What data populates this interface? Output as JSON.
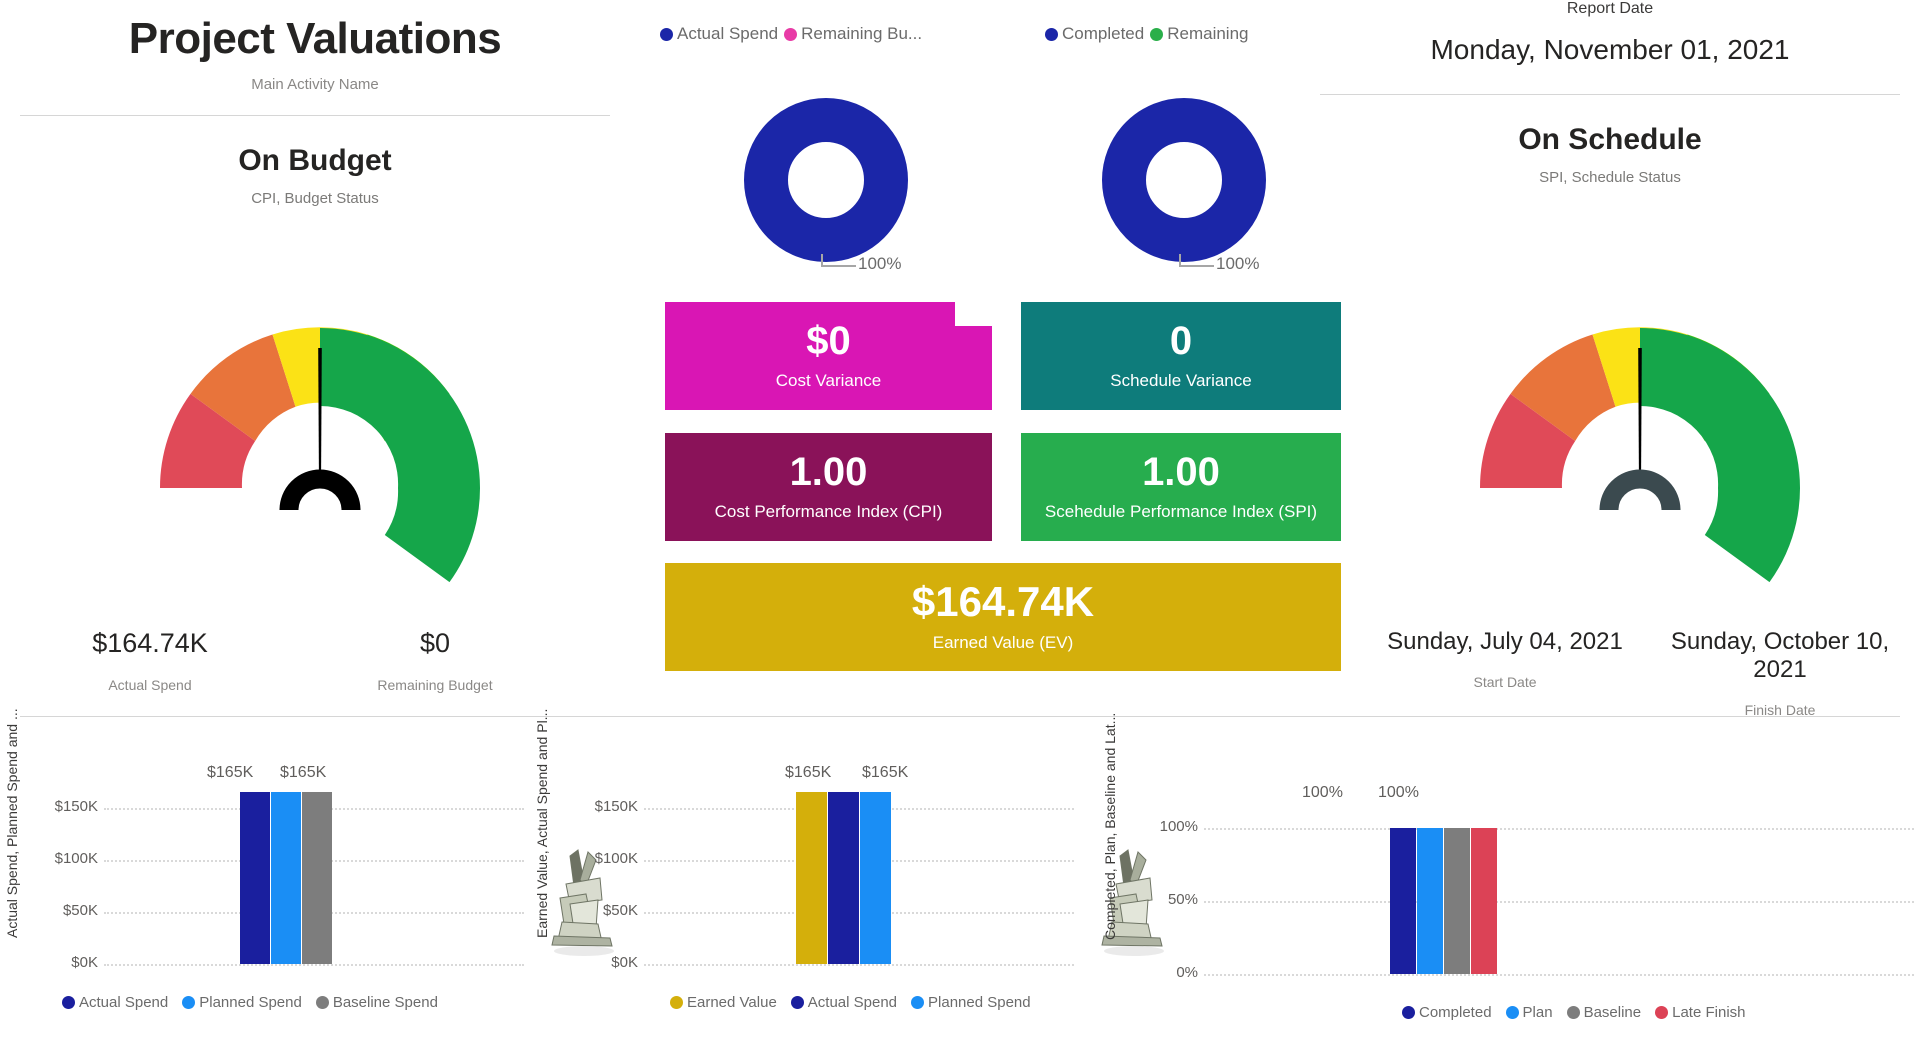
{
  "header": {
    "title": "Project Valuations",
    "subtitle": "Main Activity Name",
    "report_date_label": "Report Date",
    "report_date_value": "Monday, November 01, 2021"
  },
  "budget_panel": {
    "title": "On Budget",
    "subtitle": "CPI, Budget Status",
    "needle_color": "#000000",
    "hub_color": "#000000",
    "left_value": "$164.74K",
    "left_label": "Actual Spend",
    "right_value": "$0",
    "right_label": "Remaining Budget"
  },
  "schedule_panel": {
    "title": "On Schedule",
    "subtitle": "SPI, Schedule Status",
    "needle_color": "#000000",
    "hub_color": "#3b4a4f",
    "left_value": "Sunday, July 04, 2021",
    "left_label": "Start Date",
    "right_value": "Sunday, October 10, 2021",
    "right_label": "Finish Date"
  },
  "gauge_bands": [
    {
      "name": "red",
      "color": "#e04a58"
    },
    {
      "name": "orange",
      "color": "#e8743b"
    },
    {
      "name": "yellow",
      "color": "#fbe216"
    },
    {
      "name": "lightgreen",
      "color": "#4cc800"
    },
    {
      "name": "green",
      "color": "#15a64a"
    }
  ],
  "donuts": [
    {
      "name": "spend-donut",
      "legend": [
        {
          "label": "Actual Spend",
          "color": "#1b26a8"
        },
        {
          "label": "Remaining Bu...",
          "color": "#e83ba6"
        }
      ],
      "value_label": "100%",
      "ring_color": "#1b26a8"
    },
    {
      "name": "progress-donut",
      "legend": [
        {
          "label": "Completed",
          "color": "#1b26a8"
        },
        {
          "label": "Remaining",
          "color": "#2aaf4a"
        }
      ],
      "value_label": "100%",
      "ring_color": "#1b26a8"
    }
  ],
  "kpi_cards": [
    {
      "name": "cost-variance",
      "value": "$0",
      "label": "Cost Variance",
      "color": "#d916b4",
      "notch": true
    },
    {
      "name": "schedule-variance",
      "value": "0",
      "label": "Schedule Variance",
      "color": "#0e7c7b",
      "notch": false
    },
    {
      "name": "cpi",
      "value": "1.00",
      "label": "Cost Performance Index (CPI)",
      "color": "#8a1259",
      "notch": false
    },
    {
      "name": "spi",
      "value": "1.00",
      "label": "Scehedule Performance Index (SPI)",
      "color": "#27ad4e",
      "notch": false
    },
    {
      "name": "earned-value",
      "value": "$164.74K",
      "label": "Earned Value (EV)",
      "color": "#d4af0b",
      "notch": false
    }
  ],
  "chart_data": [
    {
      "name": "spend-comparison-chart",
      "type": "bar",
      "ylabel": "Actual Spend, Planned Spend and ...",
      "categories": [
        ""
      ],
      "yticks": [
        "$0K",
        "$50K",
        "$100K",
        "$150K"
      ],
      "ytick_values": [
        0,
        50000,
        100000,
        150000
      ],
      "ylim": [
        0,
        175000
      ],
      "grid": true,
      "legend_position": "bottom",
      "series": [
        {
          "name": "Actual Spend",
          "color": "#1a1f9e",
          "values": [
            165000
          ],
          "data_label": "$165K"
        },
        {
          "name": "Planned Spend",
          "color": "#1a8ef5",
          "values": [
            165000
          ],
          "data_label": "$165K"
        },
        {
          "name": "Baseline Spend",
          "color": "#7d7d7d",
          "values": [
            165000
          ],
          "data_label": ""
        }
      ]
    },
    {
      "name": "earned-value-chart",
      "type": "bar",
      "ylabel": "Earned Value, Actual Spend and Pl...",
      "categories": [
        ""
      ],
      "yticks": [
        "$0K",
        "$50K",
        "$100K",
        "$150K"
      ],
      "ytick_values": [
        0,
        50000,
        100000,
        150000
      ],
      "ylim": [
        0,
        175000
      ],
      "grid": true,
      "legend_position": "bottom",
      "series": [
        {
          "name": "Earned Value",
          "color": "#d4af0b",
          "values": [
            165000
          ],
          "data_label": "$165K"
        },
        {
          "name": "Actual Spend",
          "color": "#1a1f9e",
          "values": [
            165000
          ],
          "data_label": "$165K"
        },
        {
          "name": "Planned Spend",
          "color": "#1a8ef5",
          "values": [
            165000
          ],
          "data_label": ""
        }
      ]
    },
    {
      "name": "completion-chart",
      "type": "bar",
      "ylabel": "Completed, Plan, Baseline and Lat...",
      "categories": [
        ""
      ],
      "yticks": [
        "0%",
        "50%",
        "100%"
      ],
      "ytick_values": [
        0,
        50,
        100
      ],
      "ylim": [
        0,
        108
      ],
      "grid": true,
      "legend_position": "bottom",
      "series": [
        {
          "name": "Completed",
          "color": "#1a1f9e",
          "values": [
            100
          ],
          "data_label": "100%"
        },
        {
          "name": "Plan",
          "color": "#1a8ef5",
          "values": [
            100
          ],
          "data_label": "100%"
        },
        {
          "name": "Baseline",
          "color": "#7d7d7d",
          "values": [
            100
          ],
          "data_label": ""
        },
        {
          "name": "Late Finish",
          "color": "#dc4256",
          "values": [
            100
          ],
          "data_label": ""
        }
      ]
    }
  ]
}
